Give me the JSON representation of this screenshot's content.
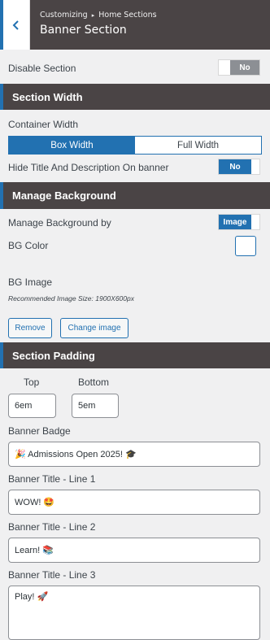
{
  "header": {
    "breadcrumb_root": "Customizing",
    "breadcrumb_sep": "▸",
    "breadcrumb_parent": "Home Sections",
    "title": "Banner Section"
  },
  "disable_section": {
    "label": "Disable Section",
    "value": "No"
  },
  "section_width": {
    "heading": "Section Width",
    "container_label": "Container Width",
    "options": [
      "Box Width",
      "Full Width"
    ],
    "selected": "Box Width",
    "hide_title_label": "Hide Title And Description On banner",
    "hide_title_value": "No"
  },
  "manage_background": {
    "heading": "Manage Background",
    "by_label": "Manage Background by",
    "by_value": "Image",
    "color_label": "BG Color",
    "image_label": "BG Image",
    "image_note": "Recommended Image Size: 1900X600px",
    "remove_label": "Remove",
    "change_label": "Change image"
  },
  "section_padding": {
    "heading": "Section Padding",
    "top_label": "Top",
    "top_value": "6em",
    "bottom_label": "Bottom",
    "bottom_value": "5em"
  },
  "banner": {
    "badge_label": "Banner Badge",
    "badge_value": "🎉 Admissions Open 2025! 🎓",
    "line1_label": "Banner Title - Line 1",
    "line1_value": "WOW! 🤩",
    "line2_label": "Banner Title - Line 2",
    "line2_value": "Learn! 📚",
    "line3_label": "Banner Title - Line 3",
    "line3_value": "Play! 🚀"
  },
  "colors": {
    "accent": "#2271b1",
    "header_bg": "#4a4445",
    "toggle_off": "#8c8f94"
  }
}
